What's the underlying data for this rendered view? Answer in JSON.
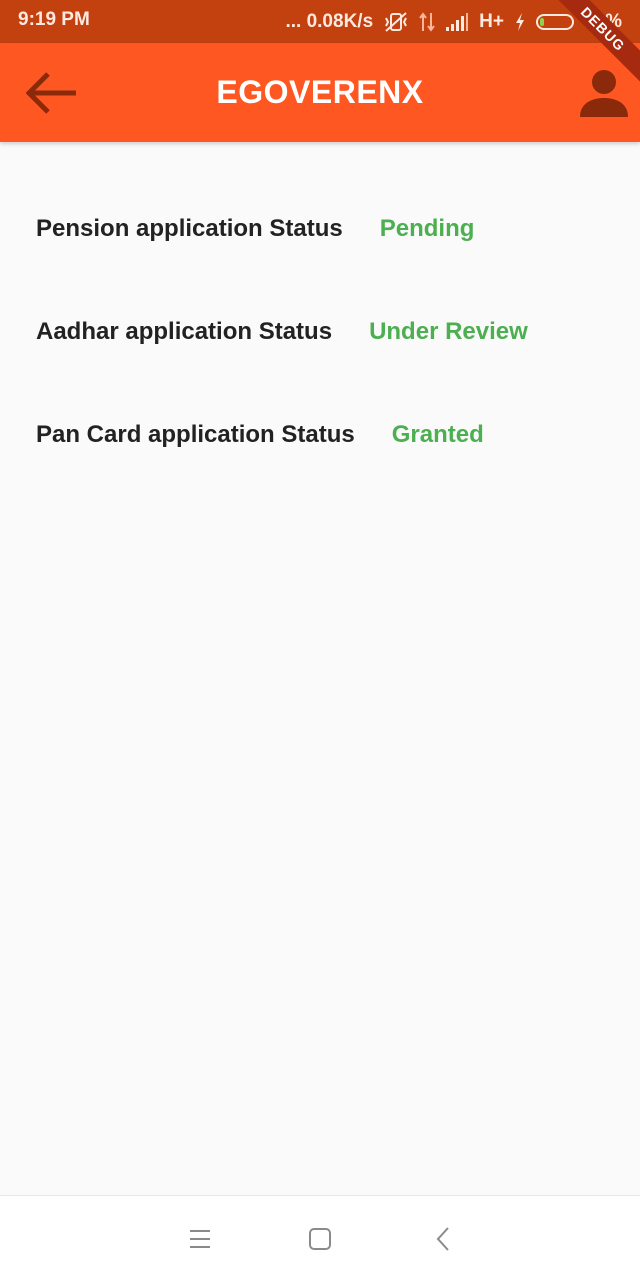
{
  "status_bar": {
    "time": "9:19 PM",
    "network_speed": "... 0.08K/s",
    "network_type": "H+",
    "battery_percent": "14%",
    "battery_level": 0.14,
    "icons": [
      "vibrate-off-icon",
      "data-transfer-icon",
      "signal-icon",
      "charging-bolt-icon",
      "battery-icon"
    ]
  },
  "app_bar": {
    "title": "EGOVERENX",
    "back_icon": "arrow-left-icon",
    "profile_icon": "person-icon",
    "debug_banner": "DEBUG"
  },
  "applications": [
    {
      "label": "Pension application Status",
      "status": "Pending"
    },
    {
      "label": "Aadhar application Status",
      "status": "Under Review"
    },
    {
      "label": "Pan Card application Status",
      "status": "Granted"
    }
  ],
  "nav_bar": {
    "icons": [
      "menu-icon",
      "home-square-icon",
      "back-chevron-icon"
    ]
  },
  "colors": {
    "app_bar": "#ff5722",
    "status_bar": "#c2410f",
    "status_value": "#4caf50",
    "label_text": "#222222",
    "background": "#fafafa",
    "icon_dark": "#8a2a0a"
  }
}
